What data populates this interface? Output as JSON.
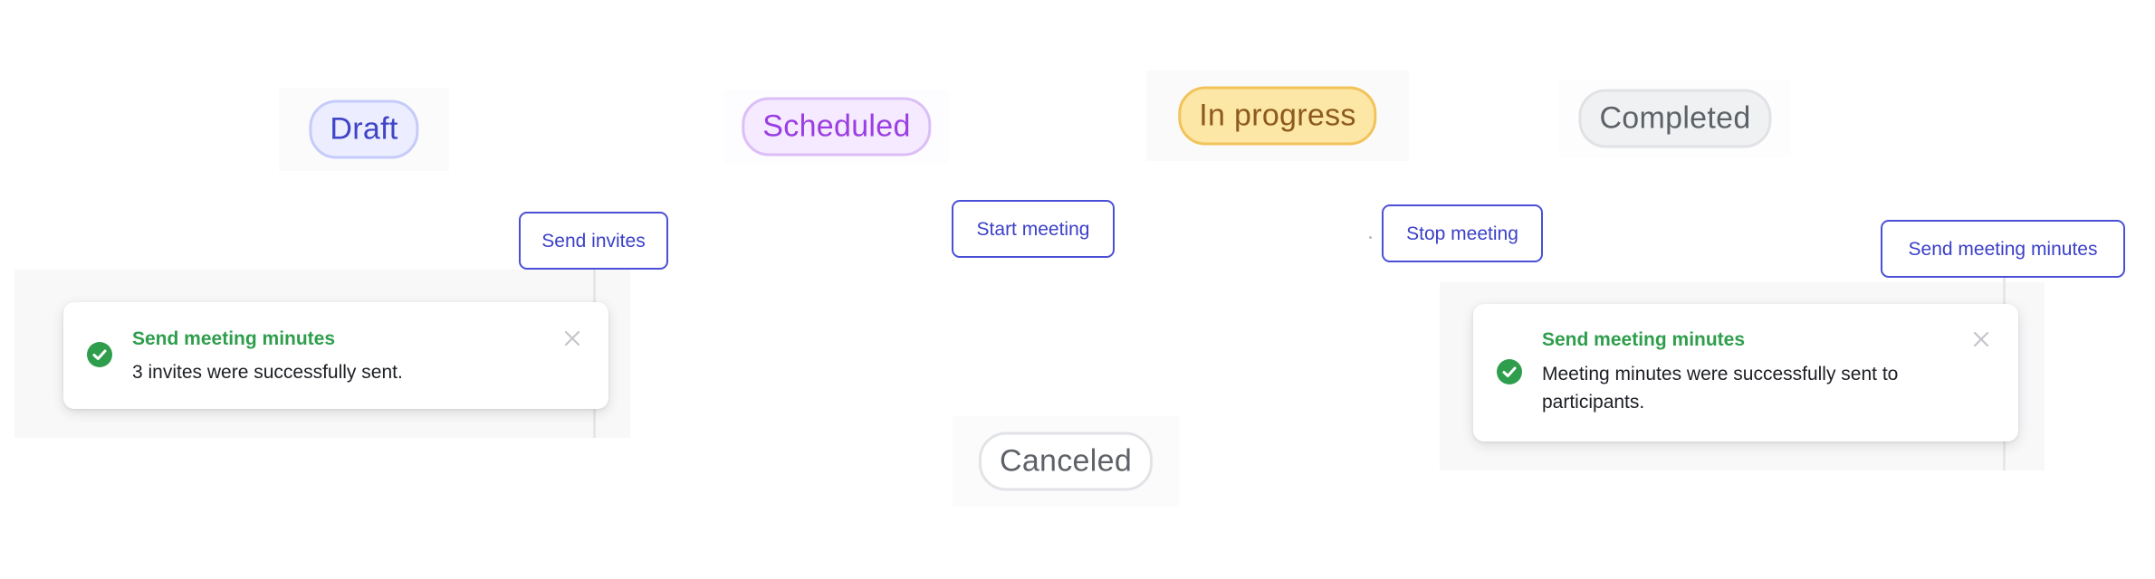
{
  "statuses": {
    "draft": "Draft",
    "scheduled": "Scheduled",
    "in_progress": "In progress",
    "completed": "Completed",
    "canceled": "Canceled"
  },
  "actions": {
    "send_invites": "Send invites",
    "start_meeting": "Start meeting",
    "stop_meeting": "Stop meeting",
    "send_minutes": "Send meeting minutes"
  },
  "toasts": [
    {
      "title": "Send meeting minutes",
      "message": "3 invites were successfully sent.",
      "icon": "check-circle-icon",
      "close_icon": "close-icon"
    },
    {
      "title": "Send meeting minutes",
      "message": "Meeting minutes were successfully sent to participants.",
      "icon": "check-circle-icon",
      "close_icon": "close-icon"
    }
  ],
  "colors": {
    "accent": "#4a4fd6",
    "success": "#2e9e4c",
    "draft": "#3f45c6",
    "scheduled": "#9a3ee3",
    "in_progress": "#f2c35a",
    "completed": "#5e6268"
  }
}
